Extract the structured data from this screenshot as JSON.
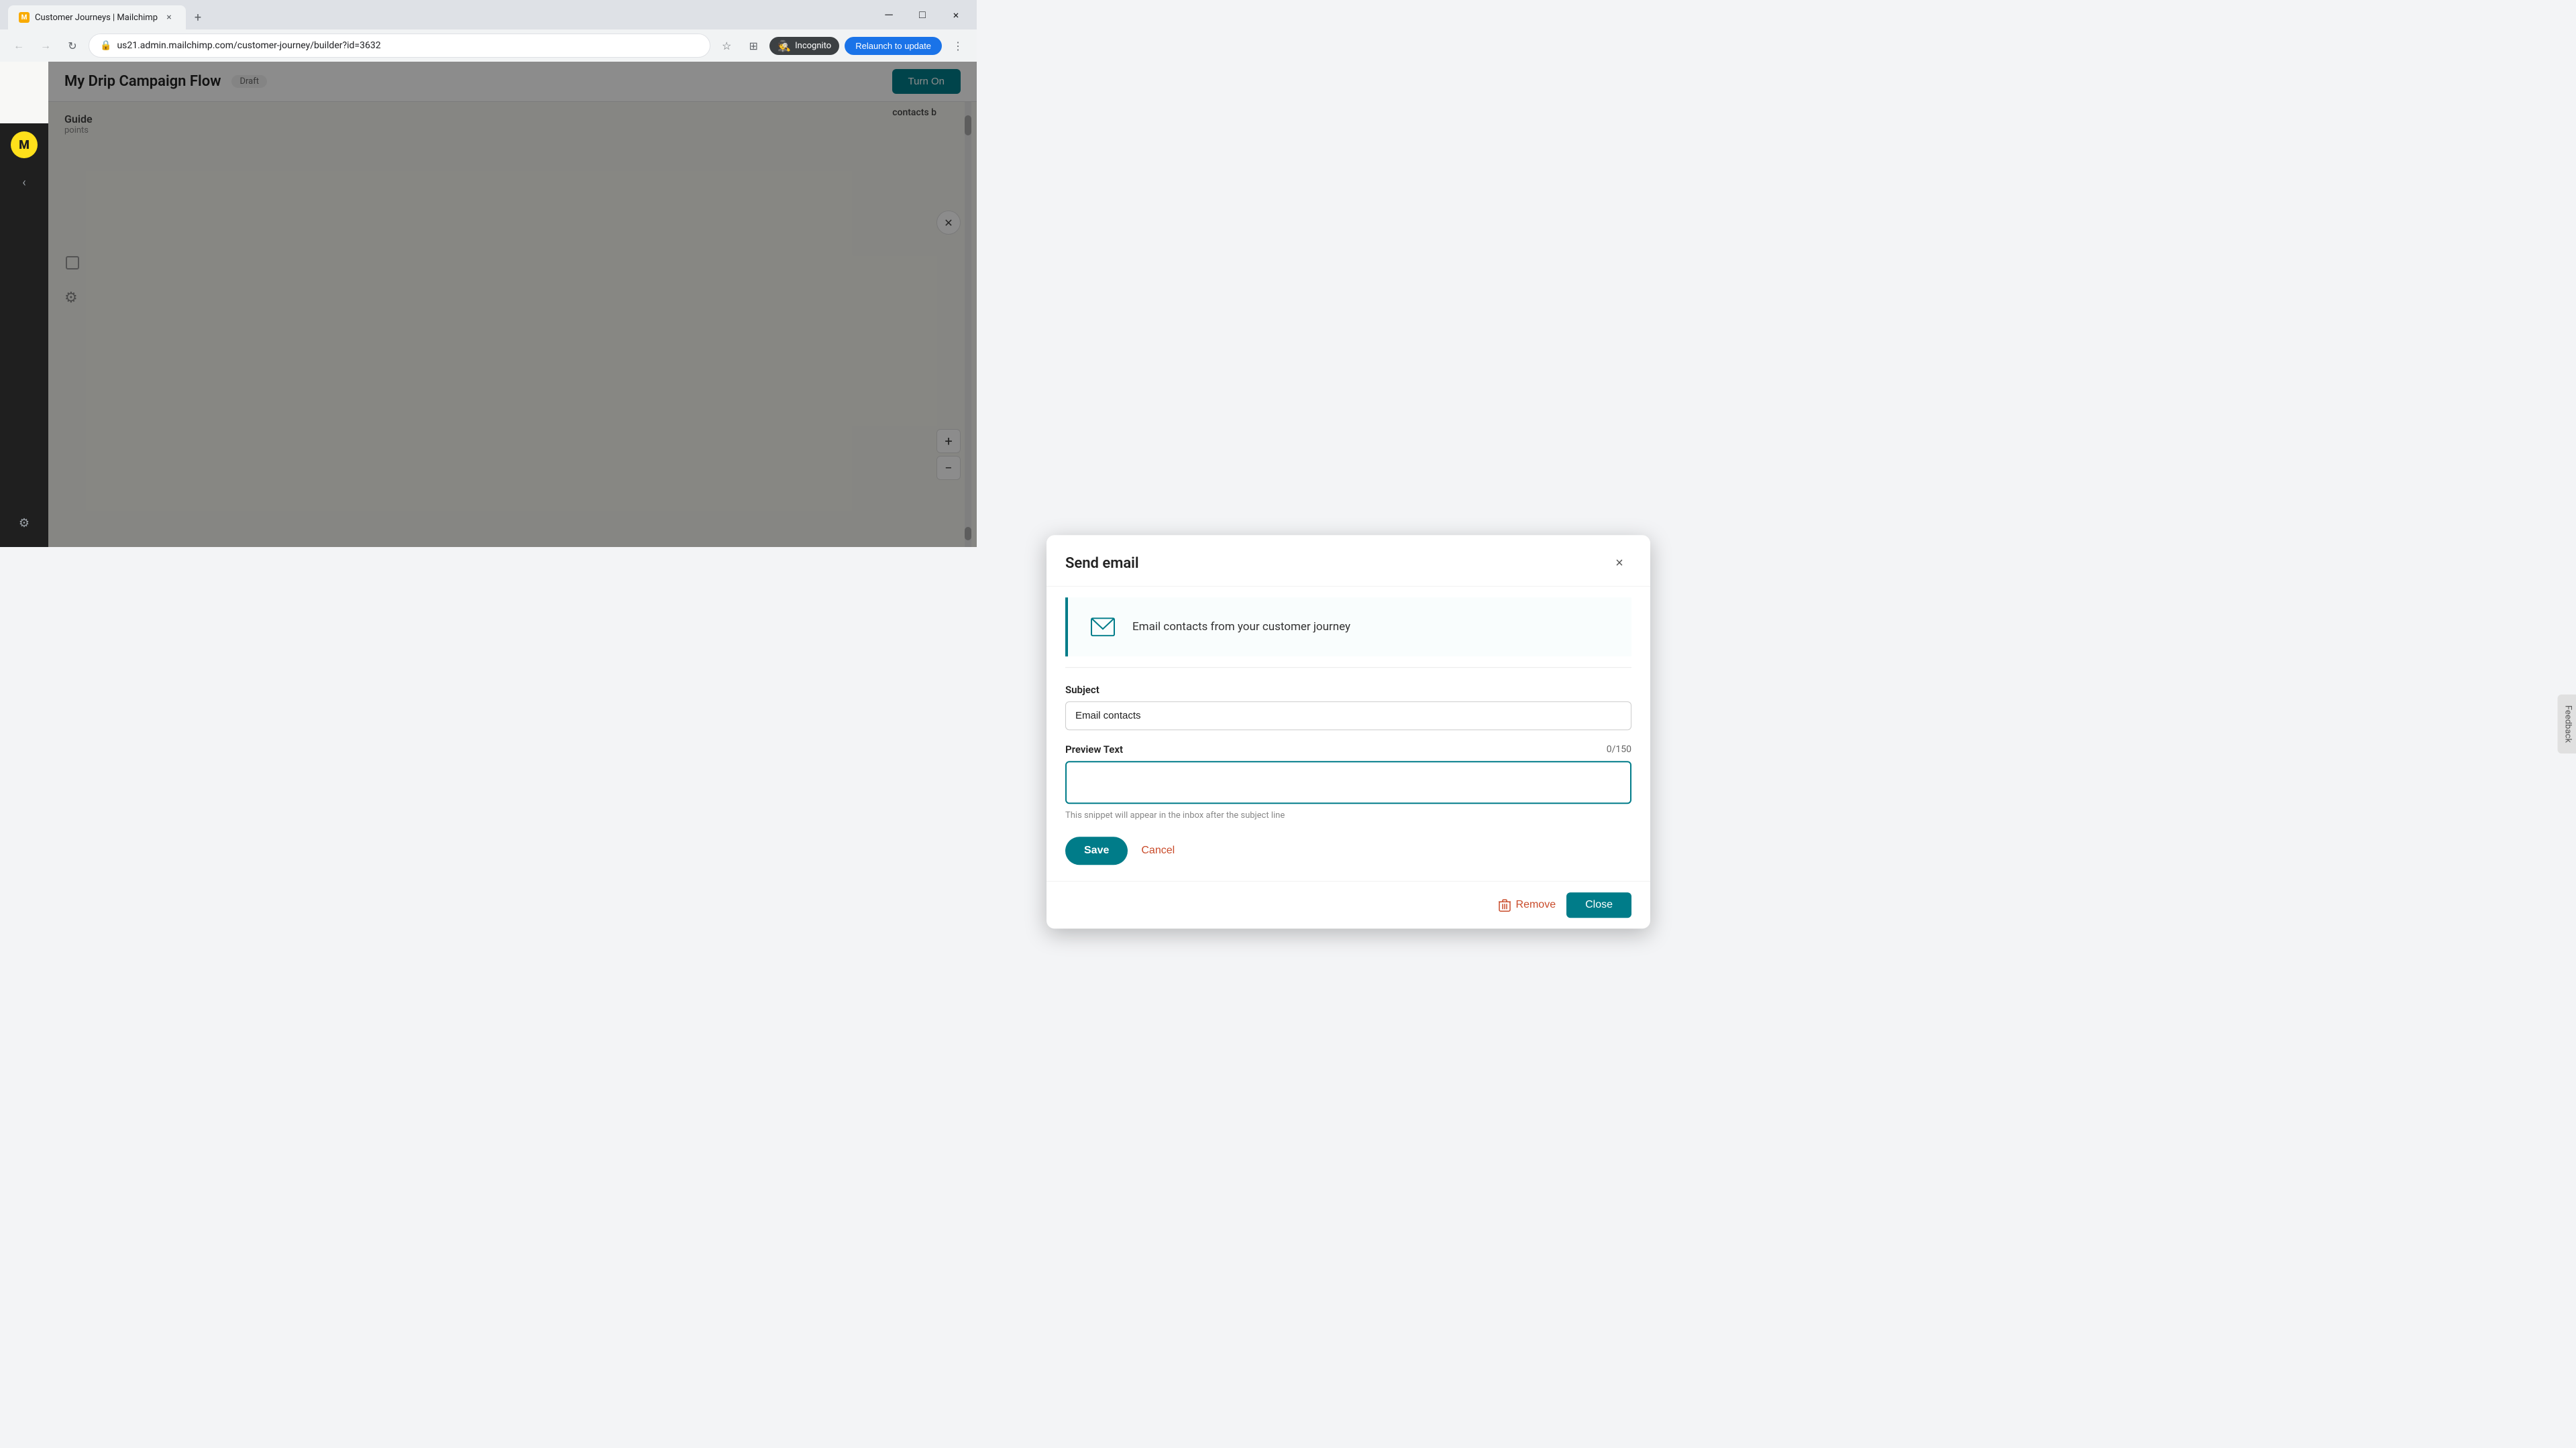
{
  "browser": {
    "tab_title": "Customer Journeys | Mailchimp",
    "tab_close": "×",
    "new_tab": "+",
    "nav_back": "←",
    "nav_forward": "→",
    "nav_reload": "↻",
    "url": "us21.admin.mailchimp.com/customer-journey/builder?id=3632",
    "bookmark_icon": "☆",
    "extensions_icon": "⊞",
    "incognito_label": "Incognito",
    "relaunch_label": "Relaunch to update",
    "menu_icon": "⋮",
    "minimize": "─",
    "maximize": "□",
    "close_window": "×"
  },
  "app": {
    "title": "My Drip Campaign Flow",
    "status_badge": "Draft",
    "publish_button": "Turn On",
    "sidebar_logo": "M",
    "guide_title": "Guide",
    "guide_subtitle": "points",
    "feedback_label": "Feedback"
  },
  "modal": {
    "title": "Send email",
    "close_button": "×",
    "email_banner_text": "Email contacts from your customer journey",
    "email_icon": "✉",
    "subject_label": "Subject",
    "subject_value": "Email contacts",
    "subject_placeholder": "Email contacts",
    "preview_text_label": "Preview Text",
    "char_count": "0/150",
    "preview_placeholder": "",
    "preview_hint": "This snippet will appear in the inbox after the subject line",
    "save_button": "Save",
    "cancel_button": "Cancel",
    "remove_button": "Remove",
    "close_modal_button": "Close"
  }
}
